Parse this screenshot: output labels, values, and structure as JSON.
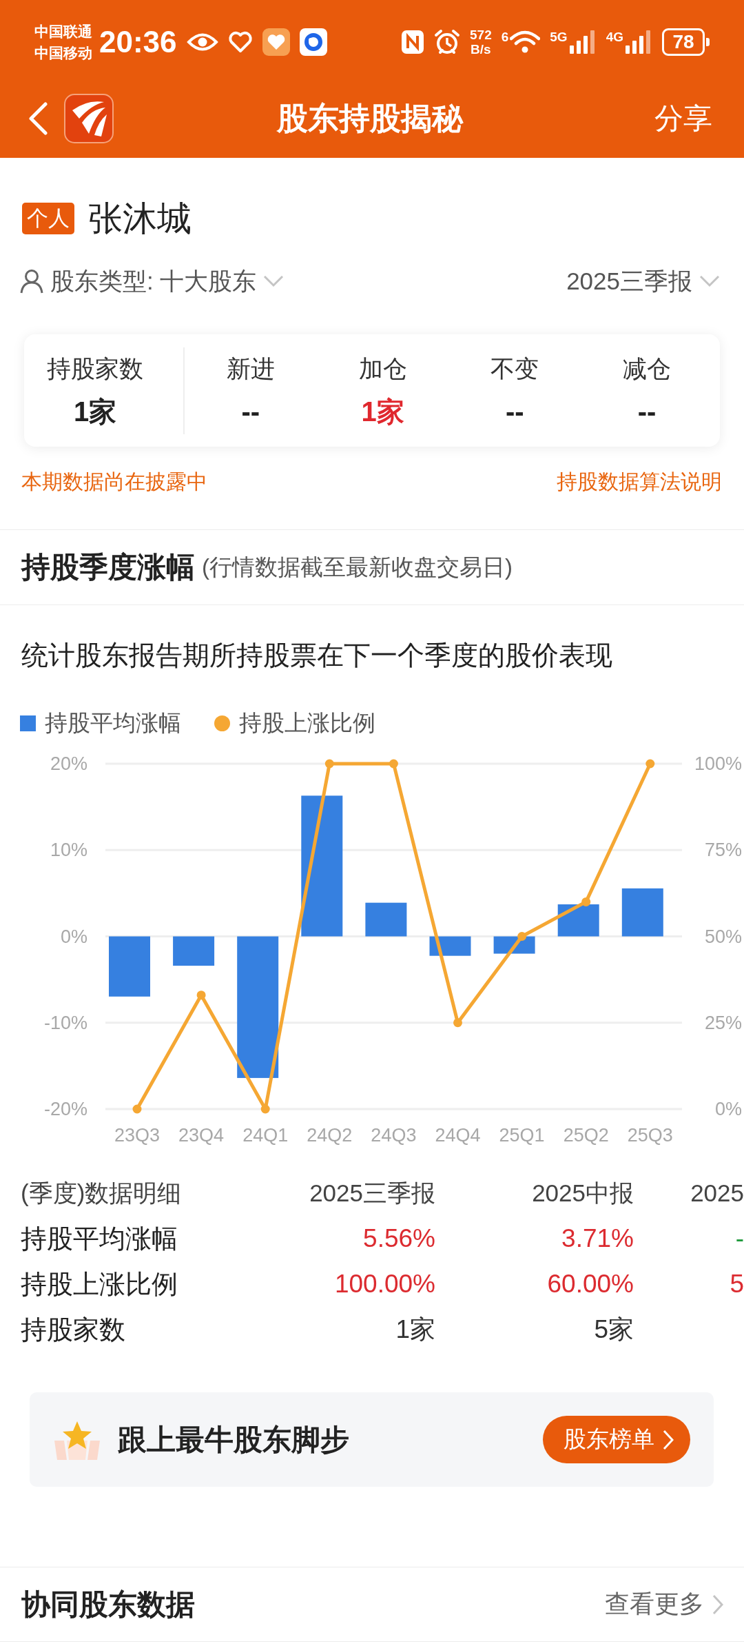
{
  "status_bar": {
    "carrier_lines": [
      "中国联通",
      "中国移动"
    ],
    "time": "20:36",
    "speed_lines": [
      "572",
      "B/s"
    ],
    "wifi_label": "6",
    "networks": [
      "5G",
      "4G"
    ],
    "battery": "78"
  },
  "nav": {
    "title": "股东持股揭秘",
    "action": "分享"
  },
  "holder": {
    "tag": "个人",
    "name": "张沐城"
  },
  "filters": {
    "type_label": "股东类型: 十大股东",
    "period": "2025三季报"
  },
  "stats": [
    {
      "label": "持股家数",
      "value": "1家",
      "color": "#222222"
    },
    {
      "label": "新进",
      "value": "--",
      "color": "#222222"
    },
    {
      "label": "加仓",
      "value": "1家",
      "color": "#e0282e"
    },
    {
      "label": "不变",
      "value": "--",
      "color": "#222222"
    },
    {
      "label": "减仓",
      "value": "--",
      "color": "#222222"
    }
  ],
  "notes": {
    "status": "本期数据尚在披露中",
    "link": "持股数据算法说明"
  },
  "section": {
    "title": "持股季度涨幅",
    "subtitle": "(行情数据截至最新收盘交易日)"
  },
  "chart_intro": "统计股东报告期所持股票在下一个季度的股价表现",
  "chart_data": {
    "type": "bar",
    "grid": true,
    "categories": [
      "23Q3",
      "23Q4",
      "24Q1",
      "24Q2",
      "24Q3",
      "24Q4",
      "25Q1",
      "25Q2",
      "25Q3"
    ],
    "series": [
      {
        "name": "持股平均涨幅",
        "color": "#3680e0",
        "values": [
          -6.97,
          -3.4,
          -16.4,
          16.3,
          3.9,
          -2.25,
          -2.0,
          3.71,
          5.56
        ]
      },
      {
        "name": "持股上涨比例",
        "type": "line",
        "axis": "y2",
        "marker": "circle",
        "color": "#f5a733",
        "values": [
          0,
          33,
          0,
          100,
          100,
          25,
          50,
          60,
          100
        ]
      }
    ],
    "ylim": [
      -20,
      20
    ],
    "yticks": [
      {
        "value": 20,
        "label": "20%"
      },
      {
        "value": 10,
        "label": "10%"
      },
      {
        "value": 0,
        "label": "0%"
      },
      {
        "value": -10,
        "label": "-10%"
      },
      {
        "value": -20,
        "label": "-20%"
      }
    ],
    "y2lim": [
      0,
      100
    ],
    "y2ticks": [
      {
        "value": 100,
        "label": "100%"
      },
      {
        "value": 75,
        "label": "75%"
      },
      {
        "value": 50,
        "label": "50%"
      },
      {
        "value": 25,
        "label": "25%"
      },
      {
        "value": 0,
        "label": "0%"
      }
    ]
  },
  "detail_table": {
    "columns": [
      "(季度)数据明细",
      "2025三季报",
      "2025中报",
      "2025"
    ],
    "rows": [
      {
        "cells": [
          {
            "text": "持股平均涨幅"
          },
          {
            "text": "5.56%",
            "color": "#dc2b30"
          },
          {
            "text": "3.71%",
            "color": "#dc2b30"
          },
          {
            "text": "-",
            "color": "#1f9a3c"
          }
        ]
      },
      {
        "cells": [
          {
            "text": "持股上涨比例"
          },
          {
            "text": "100.00%",
            "color": "#dc2b30"
          },
          {
            "text": "60.00%",
            "color": "#dc2b30"
          },
          {
            "text": "5",
            "color": "#dc2b30"
          }
        ]
      },
      {
        "cells": [
          {
            "text": "持股家数"
          },
          {
            "text": "1家",
            "color": "#333333"
          },
          {
            "text": "5家",
            "color": "#333333"
          }
        ]
      }
    ]
  },
  "banner": {
    "text": "跟上最牛股东脚步",
    "button": "股东榜单"
  },
  "related": {
    "title": "协同股东数据",
    "more": "查看更多"
  }
}
